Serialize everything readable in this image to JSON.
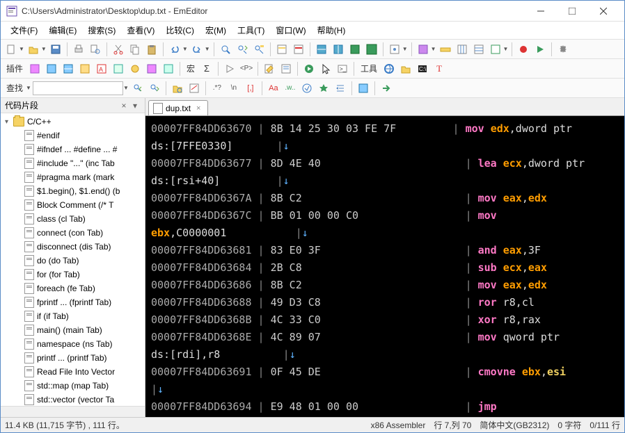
{
  "title": "C:\\Users\\Administrator\\Desktop\\dup.txt - EmEditor",
  "menu": [
    "文件(F)",
    "编辑(E)",
    "搜索(S)",
    "查看(V)",
    "比较(C)",
    "宏(M)",
    "工具(T)",
    "窗口(W)",
    "帮助(H)"
  ],
  "toolbar2_labels": {
    "plugins": "插件",
    "macro": "宏",
    "tools": "工具"
  },
  "toolbar3": {
    "search_label": "查找",
    "search_value": ""
  },
  "sidebar": {
    "title": "代码片段",
    "root": "C/C++",
    "items": [
      "#endif",
      "#ifndef ... #define ... #",
      "#include \"...\"  (inc Tab",
      "#pragma mark  (mark",
      "$1.begin(), $1.end()  (b",
      "Block Comment  (/* T",
      "class   (cl Tab)",
      "connect  (con Tab)",
      "disconnect  (dis Tab)",
      "do  (do Tab)",
      "for  (for Tab)",
      "foreach  (fe Tab)",
      "fprintf ...  (fprintf Tab)",
      "if  (if Tab)",
      "main()  (main Tab)",
      "namespace  (ns Tab)",
      "printf ...  (printf Tab)",
      "Read File Into Vector",
      "std::map  (map Tab)",
      "std::vector  (vector Ta"
    ]
  },
  "tab": {
    "name": "dup.txt"
  },
  "code_lines": [
    [
      [
        "addr",
        "00007FF84DD63670"
      ],
      [
        "bar",
        " | "
      ],
      [
        "hex",
        "8B 14 25 30 03 FE 7F         "
      ],
      [
        "bar",
        "| "
      ],
      [
        "mn",
        "mov "
      ],
      [
        "reg1",
        "edx"
      ],
      [
        "txt",
        ",dword ptr"
      ]
    ],
    [
      [
        "txt",
        "ds:[7FFE0330]       "
      ],
      [
        "bar",
        "|"
      ],
      [
        "ar",
        "↓"
      ]
    ],
    [
      [
        "addr",
        "00007FF84DD63677"
      ],
      [
        "bar",
        " | "
      ],
      [
        "hex",
        "8D 4E 40                       "
      ],
      [
        "bar",
        "| "
      ],
      [
        "mn",
        "lea "
      ],
      [
        "reg1",
        "ecx"
      ],
      [
        "txt",
        ",dword ptr"
      ]
    ],
    [
      [
        "txt",
        "ds:[rsi+40]         "
      ],
      [
        "bar",
        "|"
      ],
      [
        "ar",
        "↓"
      ]
    ],
    [
      [
        "addr",
        "00007FF84DD6367A"
      ],
      [
        "bar",
        " | "
      ],
      [
        "hex",
        "8B C2                          "
      ],
      [
        "bar",
        "| "
      ],
      [
        "mn",
        "mov "
      ],
      [
        "reg1",
        "eax"
      ],
      [
        "txt",
        ","
      ],
      [
        "reg1",
        "edx"
      ],
      [
        "txt",
        "                    "
      ],
      [
        "bar",
        "|"
      ],
      [
        "ar",
        "↓"
      ]
    ],
    [
      [
        "addr",
        "00007FF84DD6367C"
      ],
      [
        "bar",
        " | "
      ],
      [
        "hex",
        "BB 01 00 00 C0                 "
      ],
      [
        "bar",
        "| "
      ],
      [
        "mn",
        "mov"
      ]
    ],
    [
      [
        "reg1",
        "ebx"
      ],
      [
        "txt",
        ",C0000001           "
      ],
      [
        "bar",
        "|"
      ],
      [
        "ar",
        "↓"
      ]
    ],
    [
      [
        "addr",
        "00007FF84DD63681"
      ],
      [
        "bar",
        " | "
      ],
      [
        "hex",
        "83 E0 3F                       "
      ],
      [
        "bar",
        "| "
      ],
      [
        "mn",
        "and "
      ],
      [
        "reg1",
        "eax"
      ],
      [
        "txt",
        ",3F                    "
      ],
      [
        "bar",
        "|"
      ],
      [
        "ar",
        "↓"
      ]
    ],
    [
      [
        "addr",
        "00007FF84DD63684"
      ],
      [
        "bar",
        " | "
      ],
      [
        "hex",
        "2B C8                          "
      ],
      [
        "bar",
        "| "
      ],
      [
        "mn",
        "sub "
      ],
      [
        "reg1",
        "ecx"
      ],
      [
        "txt",
        ","
      ],
      [
        "reg1",
        "eax"
      ],
      [
        "txt",
        "                    "
      ],
      [
        "bar",
        "|"
      ],
      [
        "ar",
        "↓"
      ]
    ],
    [
      [
        "addr",
        "00007FF84DD63686"
      ],
      [
        "bar",
        " | "
      ],
      [
        "hex",
        "8B C2                          "
      ],
      [
        "bar",
        "| "
      ],
      [
        "mn",
        "mov "
      ],
      [
        "reg1",
        "eax"
      ],
      [
        "txt",
        ","
      ],
      [
        "reg1",
        "edx"
      ],
      [
        "txt",
        "                    "
      ],
      [
        "bar",
        "|"
      ],
      [
        "ar",
        "↓"
      ]
    ],
    [
      [
        "addr",
        "00007FF84DD63688"
      ],
      [
        "bar",
        " | "
      ],
      [
        "hex",
        "49 D3 C8                       "
      ],
      [
        "bar",
        "| "
      ],
      [
        "mn",
        "ror "
      ],
      [
        "txt",
        "r8,cl                      "
      ],
      [
        "bar",
        "|"
      ],
      [
        "ar",
        "↓"
      ]
    ],
    [
      [
        "addr",
        "00007FF84DD6368B"
      ],
      [
        "bar",
        " | "
      ],
      [
        "hex",
        "4C 33 C0                       "
      ],
      [
        "bar",
        "| "
      ],
      [
        "mn",
        "xor "
      ],
      [
        "txt",
        "r8,rax                     "
      ],
      [
        "bar",
        "|"
      ],
      [
        "ar",
        "↓"
      ]
    ],
    [
      [
        "addr",
        "00007FF84DD6368E"
      ],
      [
        "bar",
        " | "
      ],
      [
        "hex",
        "4C 89 07                       "
      ],
      [
        "bar",
        "| "
      ],
      [
        "mn",
        "mov "
      ],
      [
        "txt",
        "qword ptr"
      ]
    ],
    [
      [
        "txt",
        "ds:[rdi],r8          "
      ],
      [
        "bar",
        "|"
      ],
      [
        "ar",
        "↓"
      ]
    ],
    [
      [
        "addr",
        "00007FF84DD63691"
      ],
      [
        "bar",
        " | "
      ],
      [
        "hex",
        "0F 45 DE                       "
      ],
      [
        "bar",
        "| "
      ],
      [
        "mn",
        "cmovne "
      ],
      [
        "reg1",
        "ebx"
      ],
      [
        "txt",
        ","
      ],
      [
        "reg1e",
        "esi"
      ]
    ],
    [
      [
        "bar",
        "|"
      ],
      [
        "ar",
        "↓"
      ]
    ],
    [
      [
        "addr",
        "00007FF84DD63694"
      ],
      [
        "bar",
        " | "
      ],
      [
        "hex",
        "E9 48 01 00 00                 "
      ],
      [
        "bar",
        "| "
      ],
      [
        "mn",
        "jmp"
      ]
    ]
  ],
  "status": {
    "size": "11.4 KB (11,715 字节) , 111 行。",
    "lang": "x86 Assembler",
    "pos": "行 7,列 70",
    "enc": "简体中文(GB2312)",
    "chars": "0 字符",
    "lines": "0/111 行"
  }
}
